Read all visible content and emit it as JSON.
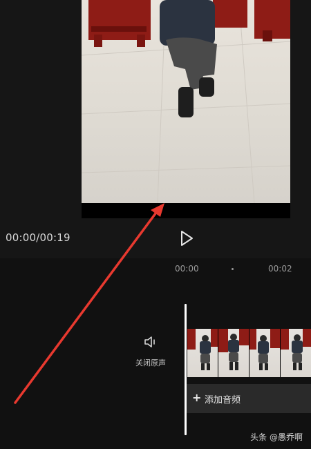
{
  "player": {
    "time_readout": "00:00/00:19",
    "play_icon": "play-icon"
  },
  "timeline": {
    "ruler": [
      "00:00",
      "00:02"
    ],
    "mute": {
      "icon": "speaker-icon",
      "label": "关闭原声"
    },
    "add_audio": {
      "icon": "plus-icon",
      "label": "添加音频"
    }
  },
  "watermark": "头条 @愚乔啊",
  "annotation": {
    "color": "#e8392f"
  }
}
